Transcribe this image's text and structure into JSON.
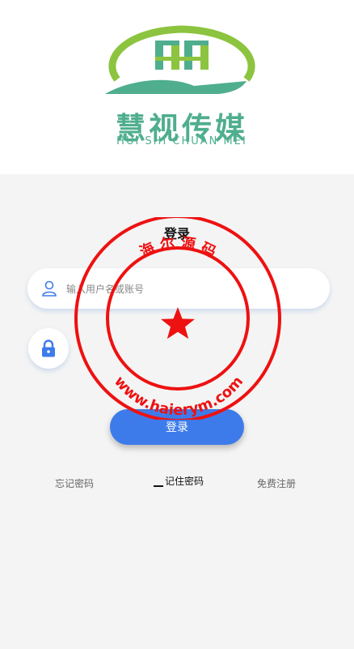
{
  "logo": {
    "chinese": "慧视传媒",
    "pinyin": "HUI SHI CHUAN MEI"
  },
  "login": {
    "title": "登录",
    "username_placeholder": "输入用户名或账号",
    "submit_label": "登录"
  },
  "links": {
    "forgot": "忘记密码",
    "remember": "记住密码",
    "register": "免费注册"
  },
  "watermark": {
    "top_text": "海 尔 源 码",
    "bottom_text": "www.haierym.com"
  },
  "colors": {
    "brand_green": "#4fae8e",
    "accent_blue": "#3e7bea",
    "stamp_red": "#ee1111"
  }
}
